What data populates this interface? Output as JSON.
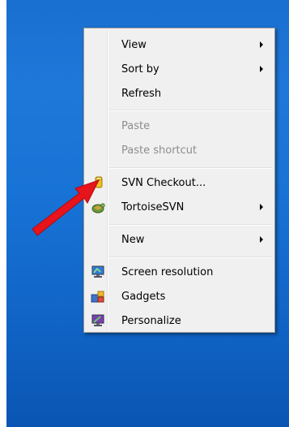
{
  "context_menu": {
    "items": [
      {
        "label": "View",
        "submenu": true,
        "enabled": true
      },
      {
        "label": "Sort by",
        "submenu": true,
        "enabled": true
      },
      {
        "label": "Refresh",
        "submenu": false,
        "enabled": true
      },
      {
        "label": "Paste",
        "submenu": false,
        "enabled": false
      },
      {
        "label": "Paste shortcut",
        "submenu": false,
        "enabled": false
      },
      {
        "label": "SVN Checkout...",
        "submenu": false,
        "enabled": true,
        "icon": "svn-checkout-icon"
      },
      {
        "label": "TortoiseSVN",
        "submenu": true,
        "enabled": true,
        "icon": "tortoisesvn-icon"
      },
      {
        "label": "New",
        "submenu": true,
        "enabled": true
      },
      {
        "label": "Screen resolution",
        "submenu": false,
        "enabled": true,
        "icon": "screen-resolution-icon"
      },
      {
        "label": "Gadgets",
        "submenu": false,
        "enabled": true,
        "icon": "gadgets-icon"
      },
      {
        "label": "Personalize",
        "submenu": false,
        "enabled": true,
        "icon": "personalize-icon"
      }
    ]
  },
  "annotation": {
    "icon": "red-arrow-icon",
    "color": "#e8141b"
  },
  "colors": {
    "desktop": "#1a6fd0",
    "menu_bg": "#f0f0f0",
    "disabled_text": "#8d8d8d"
  }
}
